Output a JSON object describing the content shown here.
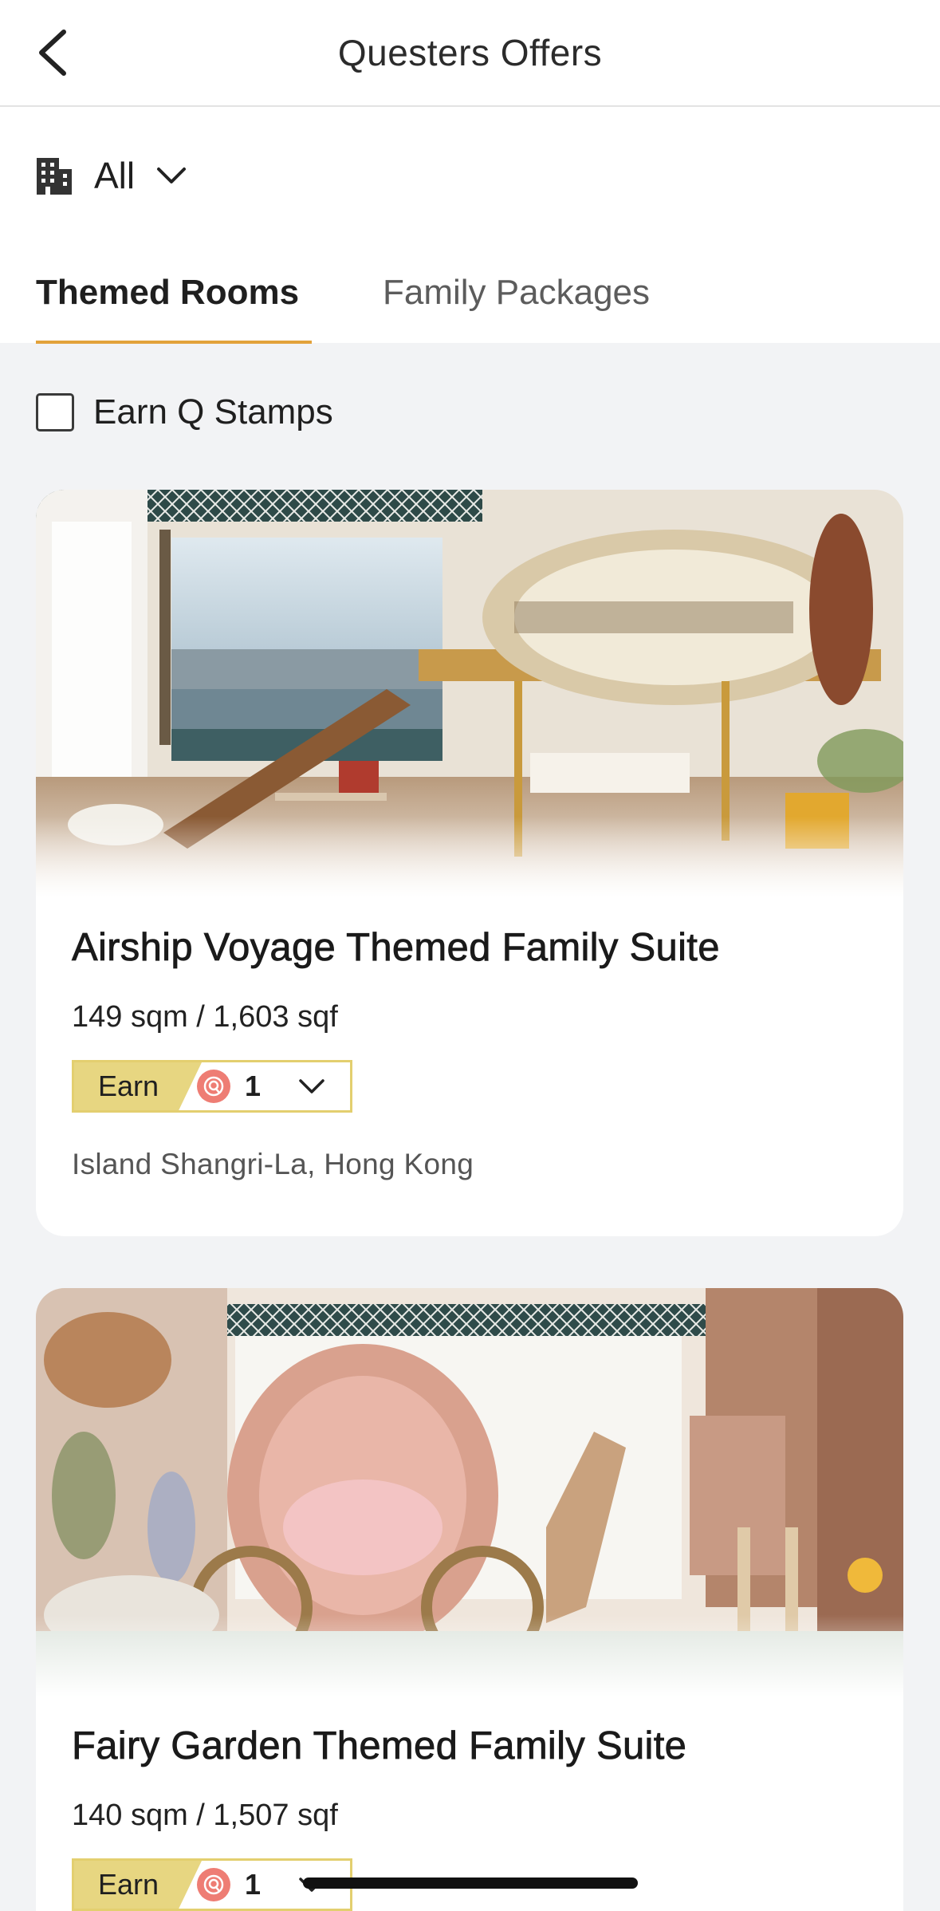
{
  "header": {
    "title": "Questers Offers",
    "back_icon": "chevron-left-icon"
  },
  "hotel_filter": {
    "icon": "building-icon",
    "value": "All",
    "dropdown_icon": "chevron-down-icon"
  },
  "tabs": [
    {
      "label": "Themed Rooms",
      "active": true
    },
    {
      "label": "Family Packages",
      "active": false
    }
  ],
  "earn_filter": {
    "label": "Earn Q Stamps",
    "checked": false
  },
  "offers": [
    {
      "title": "Airship Voyage Themed Family Suite",
      "size": "149 sqm / 1,603 sqf",
      "earn_label": "Earn",
      "stamp_count": "1",
      "stamp_icon": "q-stamp-icon",
      "hotel": "Island Shangri-La, Hong Kong"
    },
    {
      "title": "Fairy Garden Themed Family Suite",
      "size": "140 sqm / 1,507 sqf",
      "earn_label": "Earn",
      "stamp_count": "1",
      "stamp_icon": "q-stamp-icon",
      "hotel": ""
    }
  ],
  "colors": {
    "accent": "#e2a23b",
    "earn_badge": "#e7d681",
    "q_stamp": "#ee7d74",
    "background": "#f2f3f5"
  }
}
